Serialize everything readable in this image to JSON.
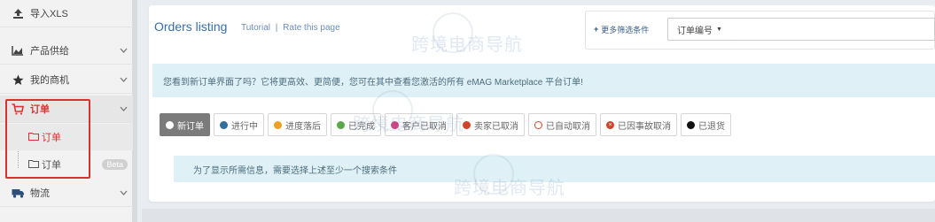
{
  "sidebar": {
    "items": [
      {
        "label": "导入XLS",
        "icon": "upload-icon"
      },
      {
        "label": "产品供给",
        "icon": "chart-icon"
      },
      {
        "label": "我的商机",
        "icon": "star-icon"
      },
      {
        "label": "订单",
        "icon": "cart-icon"
      },
      {
        "label": "物流",
        "icon": "truck-icon"
      }
    ],
    "subitems": [
      {
        "label": "订单",
        "icon": "folder-icon"
      },
      {
        "label": "订单",
        "icon": "folder-icon",
        "badge": "Beta"
      }
    ],
    "active_color": "#d8322f"
  },
  "main": {
    "title": "Orders listing",
    "tutorial": "Tutorial",
    "separator": "|",
    "rate": "Rate this page",
    "filter_more": "更多筛选条件",
    "select_value": "订单编号",
    "search_placeholder": "",
    "notice": "您看到新订单界面了吗？它将更高效、更简便，您可在其中查看您激活的所有 eMAG Marketplace 平台订单!",
    "info": "为了显示所需信息，需要选择上述至少一个搜索条件"
  },
  "statuses": [
    {
      "label": "新订单",
      "color": "#ffffff",
      "ring": false,
      "selected": true
    },
    {
      "label": "进行中",
      "color": "#2f6f9f",
      "ring": false
    },
    {
      "label": "进度落后",
      "color": "#f0a020",
      "ring": false
    },
    {
      "label": "已完成",
      "color": "#5aa84a",
      "ring": false
    },
    {
      "label": "客户已取消",
      "color": "#d04080",
      "ring": false
    },
    {
      "label": "卖家已取消",
      "color": "#d0442a",
      "ring": false
    },
    {
      "label": "已自动取消",
      "color": "#d0442a",
      "ring": true
    },
    {
      "label": "已因事故取消",
      "color": "#d0442a",
      "ring": false,
      "x": true
    },
    {
      "label": "已退货",
      "color": "#111111",
      "ring": false
    }
  ],
  "watermark": "跨境电商导航"
}
